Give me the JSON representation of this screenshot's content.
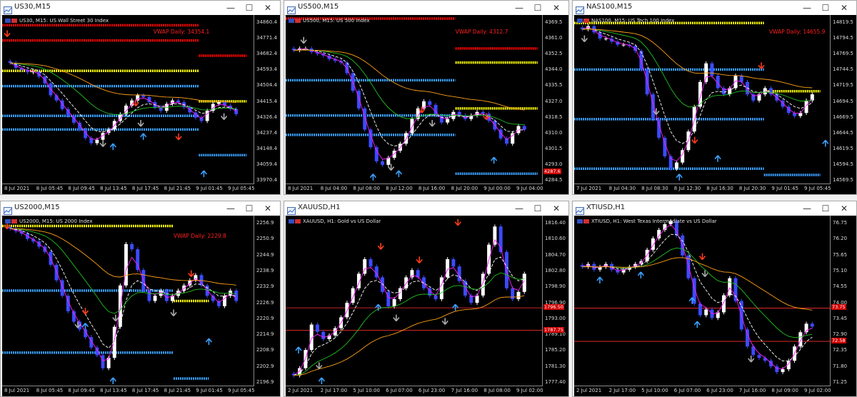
{
  "windows": [
    {
      "id": "us30",
      "title": "US30,M15",
      "header": "US30, M15:  US Wall Street 30 Index",
      "vwap": "VWAP Daily: 34354.1",
      "vwap_pos": [
        0.6,
        0.08
      ],
      "y_labels": [
        "34860.4",
        "34771.4",
        "34682.4",
        "34593.4",
        "34504.4",
        "34415.4",
        "34326.4",
        "34237.4",
        "34148.4",
        "34059.4",
        "33970.4"
      ],
      "x_labels": [
        "8 Jul 2021",
        "8 Jul 05:45",
        "8 Jul 09:45",
        "8 Jul 13:45",
        "8 Jul 17:45",
        "8 Jul 21:45",
        "9 Jul 01:45",
        "9 Jul 05:45"
      ],
      "y_range": [
        33930,
        34920
      ],
      "tag": "",
      "levels": [
        {
          "value": 34860,
          "color": "#ff0000",
          "from": 0.0,
          "to": 0.78
        },
        {
          "value": 34771,
          "color": "#ff0000",
          "from": 0.0,
          "to": 0.78
        },
        {
          "value": 34682,
          "color": "#ff0000",
          "from": 0.78,
          "to": 0.97
        },
        {
          "value": 34593,
          "color": "#ffff00",
          "from": 0.0,
          "to": 0.78
        },
        {
          "value": 34504,
          "color": "#3ba0ff",
          "from": 0.0,
          "to": 0.78
        },
        {
          "value": 34415,
          "color": "#ffff00",
          "from": 0.78,
          "to": 0.97
        },
        {
          "value": 34330,
          "color": "#3ba0ff",
          "from": 0.0,
          "to": 0.78
        },
        {
          "value": 34250,
          "color": "#3ba0ff",
          "from": 0.0,
          "to": 0.78
        },
        {
          "value": 34100,
          "color": "#3ba0ff",
          "from": 0.78,
          "to": 0.97
        }
      ],
      "closes": [
        34640,
        34610,
        34600,
        34585,
        34590,
        34560,
        34520,
        34450,
        34420,
        34370,
        34330,
        34290,
        34250,
        34200,
        34170,
        34190,
        34230,
        34250,
        34300,
        34340,
        34390,
        34420,
        34450,
        34440,
        34410,
        34380,
        34360,
        34400,
        34420,
        34410,
        34380,
        34350,
        34320,
        34300,
        34360,
        34400,
        34410,
        34390,
        34370,
        34340
      ],
      "up": [
        [
          0.8,
          0.92
        ],
        [
          0.44,
          0.76
        ],
        [
          0.56,
          0.7
        ]
      ],
      "down": [
        [
          0.02,
          0.09
        ],
        [
          0.53,
          0.5
        ],
        [
          0.7,
          0.7
        ]
      ],
      "gray": [
        [
          0.4,
          0.74
        ],
        [
          0.55,
          0.62
        ],
        [
          0.88,
          0.58
        ]
      ]
    },
    {
      "id": "us500",
      "title": "US500,M15",
      "header": "US500, M15:  US 500 Index",
      "vwap": "VWAP Daily: 4312.7",
      "vwap_pos": [
        0.66,
        0.08
      ],
      "y_labels": [
        "4369.5",
        "4361.0",
        "4352.5",
        "4344.0",
        "4335.5",
        "4327.0",
        "4318.5",
        "4310.0",
        "4301.5",
        "4293.0",
        "4284.5"
      ],
      "x_labels": [
        "8 Jul 2021",
        "8 Jul 04:00",
        "8 Jul 08:00",
        "8 Jul 12:00",
        "8 Jul 16:00",
        "8 Jul 20:00",
        "9 Jul 00:00",
        "9 Jul 04:00"
      ],
      "y_range": [
        4279,
        4375
      ],
      "tag": "4287.6",
      "levels": [
        {
          "value": 4373,
          "color": "#ff0000",
          "from": 0.0,
          "to": 0.66
        },
        {
          "value": 4356,
          "color": "#ff0000",
          "from": 0.66,
          "to": 0.98
        },
        {
          "value": 4348,
          "color": "#ffff00",
          "from": 0.66,
          "to": 0.98
        },
        {
          "value": 4338,
          "color": "#3ba0ff",
          "from": 0.0,
          "to": 0.66
        },
        {
          "value": 4322,
          "color": "#ffff00",
          "from": 0.66,
          "to": 0.98
        },
        {
          "value": 4318,
          "color": "#3ba0ff",
          "from": 0.0,
          "to": 0.66
        },
        {
          "value": 4307,
          "color": "#3ba0ff",
          "from": 0.0,
          "to": 0.66
        },
        {
          "value": 4285,
          "color": "#3ba0ff",
          "from": 0.66,
          "to": 0.98
        }
      ],
      "closes": [
        4355,
        4356,
        4356,
        4354,
        4353,
        4352,
        4350,
        4349,
        4348,
        4342,
        4332,
        4322,
        4310,
        4300,
        4292,
        4290,
        4294,
        4298,
        4302,
        4308,
        4316,
        4322,
        4326,
        4324,
        4318,
        4314,
        4316,
        4320,
        4318,
        4316,
        4318,
        4320,
        4319,
        4315,
        4310,
        4305,
        4302,
        4308,
        4312,
        4310
      ],
      "up": [
        [
          0.34,
          0.94
        ],
        [
          0.44,
          0.92
        ],
        [
          0.81,
          0.84
        ]
      ],
      "down": [
        [
          0.53,
          0.54
        ],
        [
          0.78,
          0.58
        ]
      ],
      "gray": [
        [
          0.07,
          0.13
        ],
        [
          0.41,
          0.88
        ],
        [
          0.57,
          0.62
        ]
      ]
    },
    {
      "id": "nas100",
      "title": "NAS100,M15",
      "header": "NAS100, M15:  US Tech 100 Index",
      "vwap": "VWAP Daily: 14655.9",
      "vwap_pos": [
        0.76,
        0.08
      ],
      "y_labels": [
        "14819.5",
        "14794.5",
        "14769.5",
        "14744.5",
        "14719.5",
        "14694.5",
        "14669.5",
        "14644.5",
        "14619.5",
        "14594.5",
        "14569.5"
      ],
      "x_labels": [
        "7 Jul 2021",
        "8 Jul 04:30",
        "8 Jul 08:30",
        "8 Jul 12:30",
        "8 Jul 16:30",
        "8 Jul 20:30",
        "9 Jul 01:45",
        "9 Jul 05:45"
      ],
      "y_range": [
        14555,
        14828
      ],
      "tag": "",
      "levels": [
        {
          "value": 14815,
          "color": "#ffff00",
          "from": 0.0,
          "to": 0.74
        },
        {
          "value": 14740,
          "color": "#3ba0ff",
          "from": 0.0,
          "to": 0.74
        },
        {
          "value": 14705,
          "color": "#ffff00",
          "from": 0.74,
          "to": 0.96
        },
        {
          "value": 14660,
          "color": "#3ba0ff",
          "from": 0.0,
          "to": 0.74
        },
        {
          "value": 14580,
          "color": "#3ba0ff",
          "from": 0.0,
          "to": 0.74
        },
        {
          "value": 14570,
          "color": "#3ba0ff",
          "from": 0.74,
          "to": 0.96
        }
      ],
      "closes": [
        14805,
        14810,
        14800,
        14790,
        14790,
        14785,
        14780,
        14780,
        14778,
        14770,
        14740,
        14700,
        14660,
        14630,
        14600,
        14580,
        14590,
        14610,
        14640,
        14680,
        14720,
        14750,
        14730,
        14710,
        14700,
        14710,
        14730,
        14720,
        14700,
        14690,
        14700,
        14710,
        14700,
        14690,
        14680,
        14670,
        14665,
        14670,
        14690,
        14700
      ],
      "up": [
        [
          0.41,
          0.94
        ],
        [
          0.56,
          0.83
        ],
        [
          0.98,
          0.74
        ]
      ],
      "down": [
        [
          0.47,
          0.72
        ],
        [
          0.73,
          0.28
        ]
      ],
      "gray": [
        [
          0.32,
          0.55
        ],
        [
          0.04,
          0.12
        ]
      ]
    },
    {
      "id": "us2000",
      "title": "US2000,M15",
      "header": "US2000, M15:  US 2000 Index",
      "vwap": "VWAP Daily: 2229.8",
      "vwap_pos": [
        0.68,
        0.1
      ],
      "y_labels": [
        "2256.9",
        "2250.9",
        "2244.9",
        "2238.9",
        "2232.9",
        "2226.9",
        "2220.9",
        "2214.9",
        "2208.9",
        "2202.9",
        "2196.9"
      ],
      "x_labels": [
        "8 Jul 2021",
        "8 Jul 05:45",
        "8 Jul 09:45",
        "8 Jul 13:45",
        "8 Jul 17:45",
        "8 Jul 21:45",
        "9 Jul 01:45",
        "9 Jul 05:45"
      ],
      "y_range": [
        2193,
        2259
      ],
      "tag": "",
      "levels": [
        {
          "value": 2255,
          "color": "#ffff00",
          "from": 0.0,
          "to": 0.68
        },
        {
          "value": 2230,
          "color": "#3ba0ff",
          "from": 0.0,
          "to": 0.68
        },
        {
          "value": 2226,
          "color": "#ffff00",
          "from": 0.68,
          "to": 0.82
        },
        {
          "value": 2206,
          "color": "#3ba0ff",
          "from": 0.0,
          "to": 0.68
        },
        {
          "value": 2196,
          "color": "#3ba0ff",
          "from": 0.68,
          "to": 0.82
        }
      ],
      "closes": [
        2254,
        2253,
        2252,
        2250,
        2249,
        2247,
        2245,
        2240,
        2234,
        2228,
        2222,
        2218,
        2215,
        2212,
        2208,
        2205,
        2200,
        2204,
        2216,
        2232,
        2248,
        2246,
        2238,
        2230,
        2226,
        2228,
        2230,
        2226,
        2228,
        2230,
        2232,
        2234,
        2236,
        2232,
        2228,
        2226,
        2224,
        2228,
        2230,
        2226
      ],
      "up": [
        [
          0.44,
          0.95
        ],
        [
          0.82,
          0.72
        ],
        [
          0.33,
          0.63
        ]
      ],
      "down": [
        [
          0.02,
          0.04
        ],
        [
          0.33,
          0.54
        ],
        [
          0.75,
          0.32
        ]
      ],
      "gray": [
        [
          0.3,
          0.62
        ],
        [
          0.45,
          0.58
        ],
        [
          0.68,
          0.55
        ]
      ]
    },
    {
      "id": "xauusd",
      "title": "XAUUSD,H1",
      "header": "XAUUSD, H1:  Gold vs US Dollar",
      "vwap": "",
      "vwap_pos": [
        0.6,
        0.08
      ],
      "y_labels": [
        "1816.40",
        "1810.60",
        "1804.70",
        "1802.80",
        "1798.90",
        "1796.90",
        "1793.00",
        "1789.10",
        "1785.20",
        "1781.30",
        "1777.40"
      ],
      "x_labels": [
        "2 Jul 2021",
        "2 Jul 17:00",
        "5 Jul 10:00",
        "6 Jul 07:00",
        "6 Jul 23:00",
        "7 Jul 16:00",
        "8 Jul 08:00",
        "9 Jul 02:00"
      ],
      "y_range": [
        1773,
        1820
      ],
      "tag": "1796.50",
      "tag2": "1787.75",
      "levels": [
        {
          "value": 1794.6,
          "color": "#ff3030",
          "from": 0.0,
          "to": 1.0,
          "thin": true
        },
        {
          "value": 1788.4,
          "color": "#ff3030",
          "from": 0.0,
          "to": 1.0,
          "thin": true
        }
      ],
      "closes": [
        1776,
        1778,
        1783,
        1790,
        1788,
        1786,
        1787,
        1789,
        1792,
        1796,
        1800,
        1804,
        1808,
        1806,
        1803,
        1799,
        1795,
        1797,
        1800,
        1803,
        1805,
        1803,
        1800,
        1798,
        1797,
        1803,
        1808,
        1806,
        1802,
        1798,
        1796,
        1798,
        1804,
        1812,
        1817,
        1810,
        1800,
        1797,
        1799,
        1804
      ],
      "up": [
        [
          0.14,
          0.95
        ],
        [
          0.36,
          0.52
        ],
        [
          0.66,
          0.52
        ],
        [
          0.05,
          0.77
        ]
      ],
      "down": [
        [
          0.37,
          0.16
        ],
        [
          0.52,
          0.24
        ],
        [
          0.67,
          0.02
        ]
      ],
      "gray": [
        [
          0.13,
          0.86
        ],
        [
          0.62,
          0.6
        ],
        [
          0.43,
          0.58
        ]
      ]
    },
    {
      "id": "xtiusd",
      "title": "XTIUSD,H1",
      "header": "XTIUSD, H1:  West Texas Intermediate vs US Dollar",
      "vwap": "",
      "vwap_pos": [
        0.6,
        0.08
      ],
      "y_labels": [
        "76.75",
        "76.20",
        "75.65",
        "75.10",
        "74.55",
        "74.00",
        "73.45",
        "72.90",
        "72.35",
        "71.80",
        "71.25"
      ],
      "x_labels": [
        "2 Jul 2021",
        "2 Jul 17:00",
        "5 Jul 10:00",
        "6 Jul 07:00",
        "6 Jul 23:00",
        "7 Jul 16:00",
        "8 Jul 09:00",
        "9 Jul 02:00"
      ],
      "y_range": [
        71.0,
        77.0
      ],
      "tag": "73.75",
      "tag2": "72.58",
      "levels": [
        {
          "value": 73.75,
          "color": "#ff3030",
          "from": 0.0,
          "to": 1.0,
          "thin": true
        },
        {
          "value": 72.58,
          "color": "#ff3030",
          "from": 0.0,
          "to": 1.0,
          "thin": true
        }
      ],
      "closes": [
        75.2,
        75.3,
        75.1,
        75.2,
        75.3,
        75.1,
        75.0,
        75.1,
        75.2,
        75.3,
        75.4,
        75.8,
        76.2,
        76.5,
        76.7,
        76.8,
        76.3,
        75.6,
        74.8,
        73.9,
        73.5,
        73.7,
        73.4,
        73.6,
        74.2,
        74.8,
        74.0,
        73.0,
        72.4,
        72.1,
        72.0,
        71.9,
        71.7,
        71.5,
        71.6,
        71.9,
        72.4,
        72.9,
        73.2,
        73.1
      ],
      "up": [
        [
          0.1,
          0.36
        ],
        [
          0.26,
          0.33
        ],
        [
          0.46,
          0.48
        ],
        [
          0.48,
          0.62
        ]
      ],
      "down": [
        [
          0.5,
          0.22
        ]
      ],
      "gray": [
        [
          0.51,
          0.32
        ],
        [
          0.69,
          0.82
        ]
      ]
    }
  ],
  "window_controls": {
    "minimize": "—",
    "maximize": "☐",
    "close": "✕"
  },
  "colors": {
    "bull": "#ffffff",
    "bear": "#3b4bff",
    "ema_fast": "#ff1aff",
    "ema_mid": "#ffffff",
    "sma_slow": "#21c021",
    "vwap_line": "#ff9f1a",
    "arrow_up": "#3ba0ff",
    "arrow_down": "#ff3c1a",
    "arrow_gray": "#aaaaaa"
  }
}
